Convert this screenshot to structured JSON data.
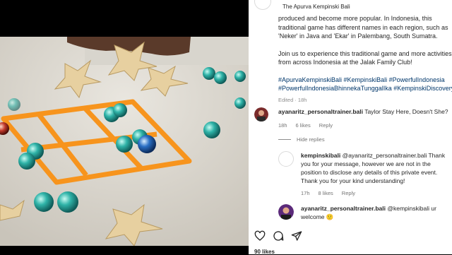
{
  "header": {
    "account_name": "The Apurva Kempinski Bali"
  },
  "caption": {
    "lines": [
      "produced and become more popular. In Indonesia, this",
      "traditional game has different names in each region, such as",
      "'Neker' in Java and 'Ekar' in Palembang, South Sumatra."
    ],
    "lines2": [
      "Join us to experience this traditional game and more activities",
      "from across Indonesia at the Jalak Family Club!"
    ],
    "hashtags": [
      "#ApurvaKempinskiBali #KempinskiBali #PowerfulIndonesia",
      "#PowerfulIndonesiaBhinnekaTunggalIka #KempinskiDiscovery"
    ],
    "meta": "Edited · 18h"
  },
  "comments": [
    {
      "user": "ayanaritz_personaltrainer.bali",
      "text": " Taylor Stay Here, Doesn't She?",
      "time": "18h",
      "likes": "6 likes",
      "reply": "Reply"
    }
  ],
  "hide_replies": "Hide replies",
  "replies": [
    {
      "user": "kempinskibali",
      "text_lines": [
        " @ayanaritz_personaltrainer.bali Thank",
        "you for your message, however we are not in the",
        "position to disclose any details of this private event.",
        "Thank you for your kind understanding!"
      ],
      "time": "17h",
      "likes": "8 likes",
      "reply": "Reply"
    },
    {
      "user": "ayanaritz_personaltrainer.bali",
      "text_lines": [
        " @kempinskibali ur",
        "welcome 🙂"
      ]
    }
  ],
  "actions": {
    "like_icon": "heart-icon",
    "comment_icon": "comment-icon",
    "share_icon": "share-icon"
  },
  "likes_peek": "90 likes",
  "colors": {
    "hashtag": "#00376b",
    "tape": "#f7941d",
    "background": "#000000"
  }
}
